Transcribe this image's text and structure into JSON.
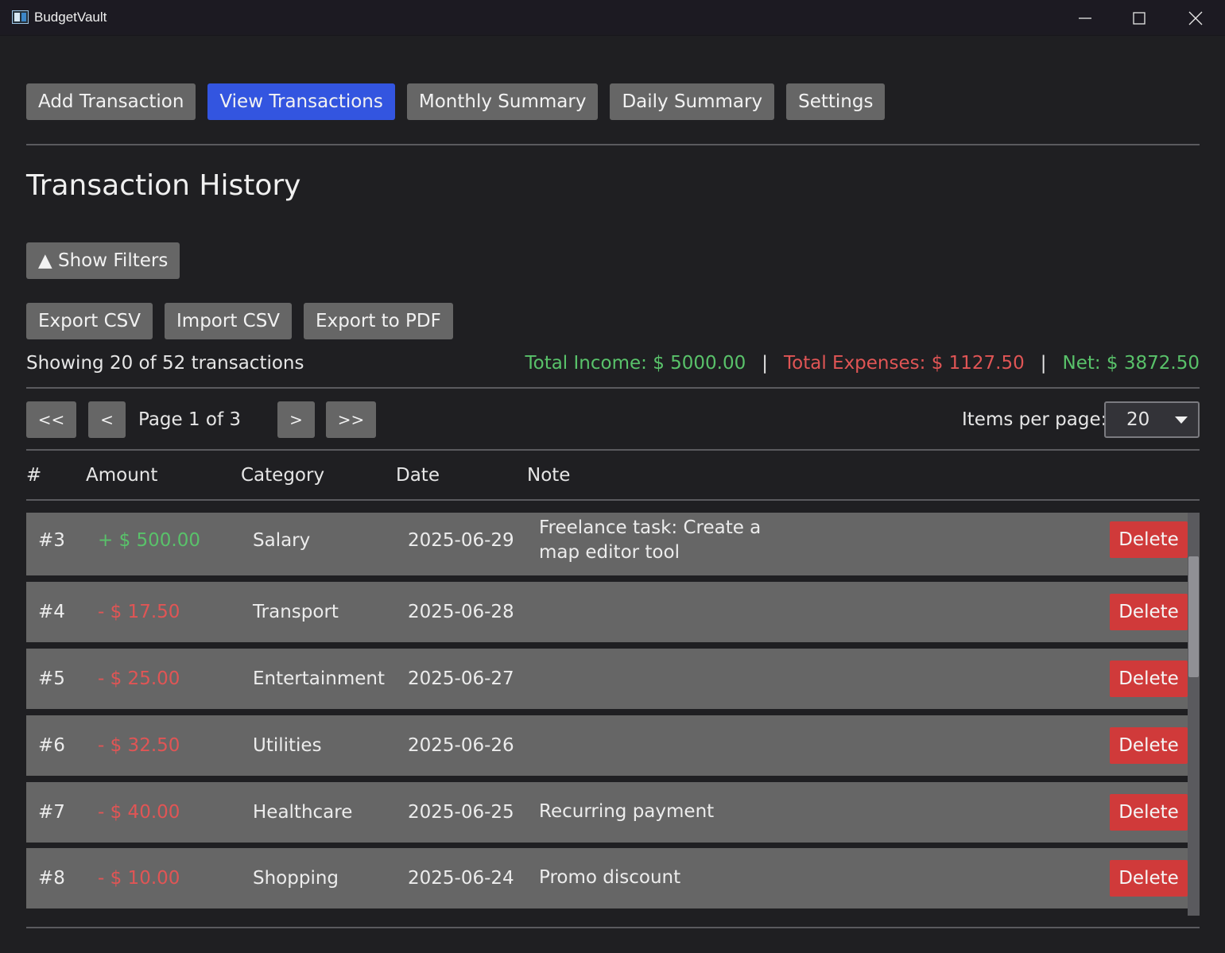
{
  "window": {
    "title": "BudgetVault",
    "icon": "app-window-icon"
  },
  "nav": {
    "items": [
      "Add Transaction",
      "View Transactions",
      "Monthly Summary",
      "Daily Summary",
      "Settings"
    ],
    "active_index": 1
  },
  "page_title": "Transaction History",
  "filters_button": "▲ Show Filters",
  "actions": {
    "export_csv": "Export CSV",
    "import_csv": "Import CSV",
    "export_pdf": "Export to PDF"
  },
  "summary": {
    "showing": "Showing 20 of 52 transactions",
    "total_income": "Total Income: $ 5000.00",
    "total_expenses": "Total Expenses: $ 1127.50",
    "net": "Net: $ 3872.50",
    "separator": "|"
  },
  "pagination": {
    "first": "<<",
    "prev": "<",
    "label": "Page 1 of 3",
    "next": ">",
    "last": ">>",
    "items_per_page_label": "Items per page:",
    "items_per_page_value": "20"
  },
  "table": {
    "headers": {
      "num": "#",
      "amount": "Amount",
      "category": "Category",
      "date": "Date",
      "note": "Note"
    },
    "delete_label": "Delete",
    "rows": [
      {
        "num": "#3",
        "amount": "+ $ 500.00",
        "type": "income",
        "category": "Salary",
        "date": "2025-06-29",
        "note": "Freelance task: Create a map editor tool"
      },
      {
        "num": "#4",
        "amount": "- $ 17.50",
        "type": "expense",
        "category": "Transport",
        "date": "2025-06-28",
        "note": ""
      },
      {
        "num": "#5",
        "amount": "- $ 25.00",
        "type": "expense",
        "category": "Entertainment",
        "date": "2025-06-27",
        "note": ""
      },
      {
        "num": "#6",
        "amount": "- $ 32.50",
        "type": "expense",
        "category": "Utilities",
        "date": "2025-06-26",
        "note": ""
      },
      {
        "num": "#7",
        "amount": "- $ 40.00",
        "type": "expense",
        "category": "Healthcare",
        "date": "2025-06-25",
        "note": "Recurring payment"
      },
      {
        "num": "#8",
        "amount": "- $ 10.00",
        "type": "expense",
        "category": "Shopping",
        "date": "2025-06-24",
        "note": "Promo discount"
      }
    ]
  },
  "colors": {
    "accent": "#3355e0",
    "income": "#59c26a",
    "expense": "#e05555",
    "delete": "#d03a3a"
  }
}
